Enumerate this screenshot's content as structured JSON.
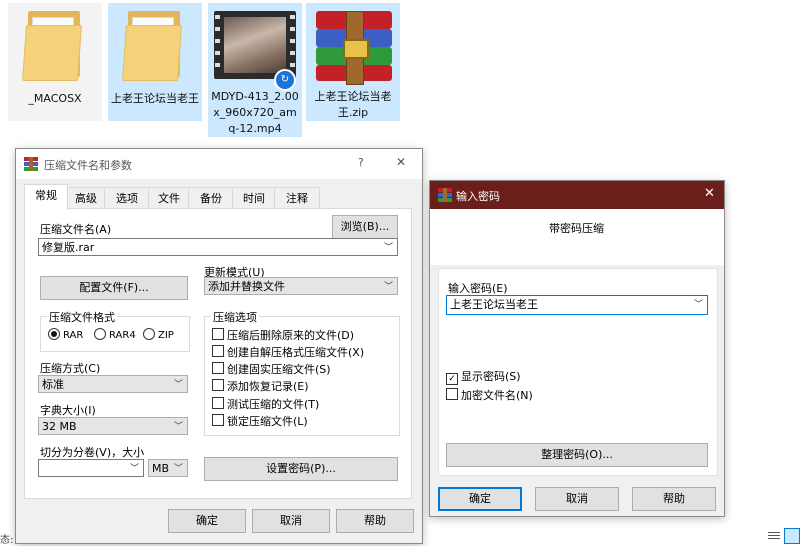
{
  "desktop": {
    "items": [
      {
        "label": "_MACOSX",
        "icon": "folder-icon"
      },
      {
        "label": "上老王论坛当老王",
        "icon": "folder-icon"
      },
      {
        "label": "MDYD-413_2.00x_960x720_amq-12.mp4",
        "icon": "video-file-icon"
      },
      {
        "label": "上老王论坛当老王.zip",
        "icon": "winrar-archive-icon"
      }
    ]
  },
  "compress_dialog": {
    "title": "压缩文件名和参数",
    "help_glyph": "?",
    "close_glyph": "✕",
    "tabs": [
      "常规",
      "高级",
      "选项",
      "文件",
      "备份",
      "时间",
      "注释"
    ],
    "active_tab": "常规",
    "archive_name_label": "压缩文件名(A)",
    "browse_button": "浏览(B)...",
    "archive_name_value": "修复版.rar",
    "profiles_button": "配置文件(F)...",
    "update_mode_label": "更新模式(U)",
    "update_mode_value": "添加并替换文件",
    "format_group": "压缩文件格式",
    "formats": [
      {
        "label": "RAR",
        "selected": true
      },
      {
        "label": "RAR4",
        "selected": false
      },
      {
        "label": "ZIP",
        "selected": false
      }
    ],
    "method_label": "压缩方式(C)",
    "method_value": "标准",
    "dict_label": "字典大小(I)",
    "dict_value": "32 MB",
    "split_label": "切分为分卷(V)，大小",
    "split_value": "",
    "split_unit": "MB",
    "options_group": "压缩选项",
    "options": [
      {
        "label": "压缩后删除原来的文件(D)",
        "checked": false
      },
      {
        "label": "创建自解压格式压缩文件(X)",
        "checked": false
      },
      {
        "label": "创建固实压缩文件(S)",
        "checked": false
      },
      {
        "label": "添加恢复记录(E)",
        "checked": false
      },
      {
        "label": "测试压缩的文件(T)",
        "checked": false
      },
      {
        "label": "锁定压缩文件(L)",
        "checked": false
      }
    ],
    "set_password_button": "设置密码(P)...",
    "ok": "确定",
    "cancel": "取消",
    "help": "帮助"
  },
  "password_dialog": {
    "title": "输入密码",
    "close_glyph": "✕",
    "heading": "带密码压缩",
    "password_label": "输入密码(E)",
    "password_value": "上老王论坛当老王",
    "show_password": {
      "label": "显示密码(S)",
      "checked": true
    },
    "encrypt_names": {
      "label": "加密文件名(N)",
      "checked": false
    },
    "organize_button": "整理密码(O)...",
    "ok": "确定",
    "cancel": "取消",
    "help": "帮助"
  },
  "taskbar_fragment": {
    "status_text": "态:"
  },
  "colors": {
    "titlebar_password": "#6b1f1a",
    "selection": "#cce8ff",
    "accent": "#0078d7"
  }
}
